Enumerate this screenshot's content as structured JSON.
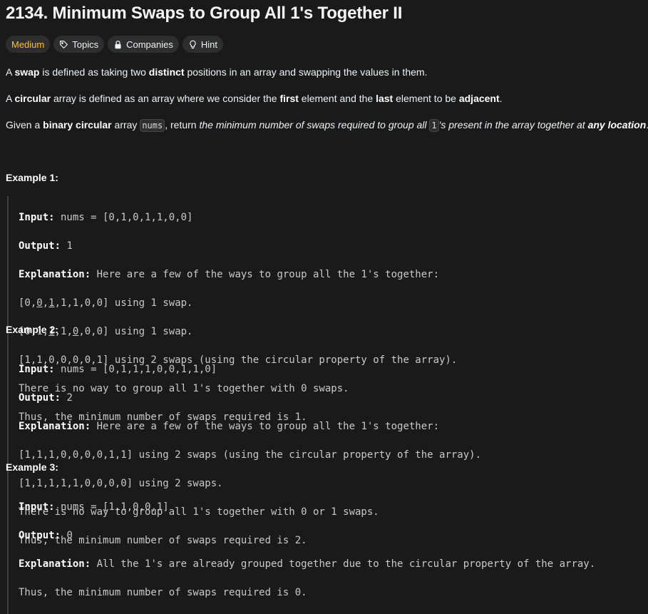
{
  "title": "2134. Minimum Swaps to Group All 1's Together II",
  "tags": {
    "difficulty": "Medium",
    "topics": "Topics",
    "companies": "Companies",
    "hint": "Hint"
  },
  "desc": {
    "p1_a": "A ",
    "p1_b": "swap",
    "p1_c": " is defined as taking two ",
    "p1_d": "distinct",
    "p1_e": " positions in an array and swapping the values in them.",
    "p2_a": "A ",
    "p2_b": "circular",
    "p2_c": " array is defined as an array where we consider the ",
    "p2_d": "first",
    "p2_e": " element and the ",
    "p2_f": "last",
    "p2_g": " element to be ",
    "p2_h": "adjacent",
    "p2_i": ".",
    "p3_a": "Given a ",
    "p3_b": "binary circular",
    "p3_c": " array ",
    "p3_code1": "nums",
    "p3_d": ", return ",
    "p3_e": "the minimum number of swaps required to group all ",
    "p3_code2": "1",
    "p3_f": "'s present in the array together at ",
    "p3_g": "any location",
    "p3_h": "."
  },
  "examples": [
    {
      "title": "Example 1:",
      "input_label": "Input:",
      "input": " nums = [0,1,0,1,1,0,0]",
      "output_label": "Output:",
      "output": " 1",
      "explanation_label": "Explanation:",
      "explanation": " Here are a few of the ways to group all the 1's together:",
      "lines": [
        "using 1 swap.",
        "using 1 swap.",
        "[1,1,0,0,0,0,1] using 2 swaps (using the circular property of the array).",
        "There is no way to group all 1's together with 0 swaps.",
        "Thus, the minimum number of swaps required is 1."
      ]
    },
    {
      "title": "Example 2:",
      "input_label": "Input:",
      "input": " nums = [0,1,1,1,0,0,1,1,0]",
      "output_label": "Output:",
      "output": " 2",
      "explanation_label": "Explanation:",
      "explanation": " Here are a few of the ways to group all the 1's together:",
      "lines": [
        "[1,1,1,0,0,0,0,1,1] using 2 swaps (using the circular property of the array).",
        "[1,1,1,1,1,0,0,0,0] using 2 swaps.",
        "There is no way to group all 1's together with 0 or 1 swaps.",
        "Thus, the minimum number of swaps required is 2."
      ]
    },
    {
      "title": "Example 3:",
      "input_label": "Input:",
      "input": " nums = [1,1,0,0,1]",
      "output_label": "Output:",
      "output": " 0",
      "explanation_label": "Explanation:",
      "explanation": " All the 1's are already grouped together due to the circular property of the array.",
      "lines": [
        "Thus, the minimum number of swaps required is 0."
      ]
    }
  ],
  "colors": {
    "background": "#1a1a1a",
    "medium": "#ffc01e",
    "tag_bg": "#2e2e2e"
  }
}
